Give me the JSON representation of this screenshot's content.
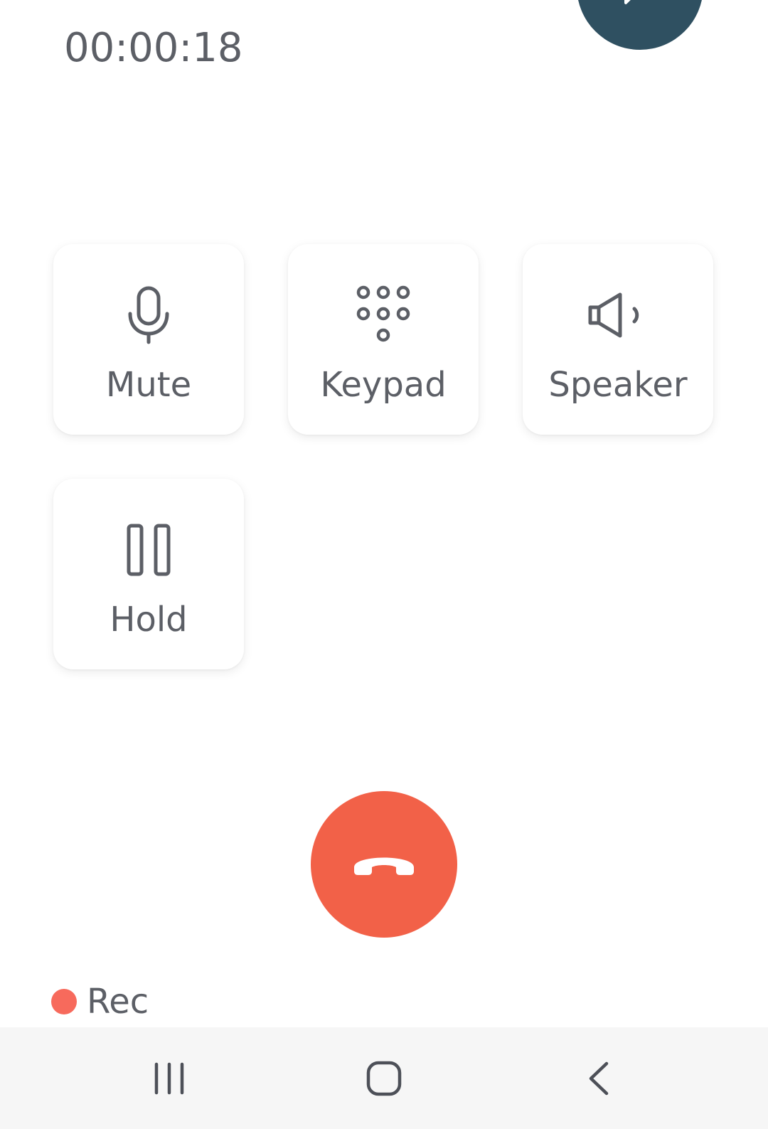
{
  "call": {
    "timer": "00:00:18"
  },
  "controls": {
    "mute_label": "Mute",
    "keypad_label": "Keypad",
    "speaker_label": "Speaker",
    "hold_label": "Hold"
  },
  "recording": {
    "label": "Rec"
  },
  "colors": {
    "hangup": "#f26148",
    "chat_fab": "#2f5061",
    "rec_dot": "#f76a5c",
    "text": "#5c5f66",
    "navbar": "#f6f6f6"
  },
  "icons": {
    "mute": "microphone-icon",
    "keypad": "dialpad-icon",
    "speaker": "speaker-icon",
    "hold": "pause-icon",
    "hangup": "end-call-icon",
    "chat": "chat-icon",
    "recents": "recents-icon",
    "home": "home-icon",
    "back": "back-icon"
  }
}
